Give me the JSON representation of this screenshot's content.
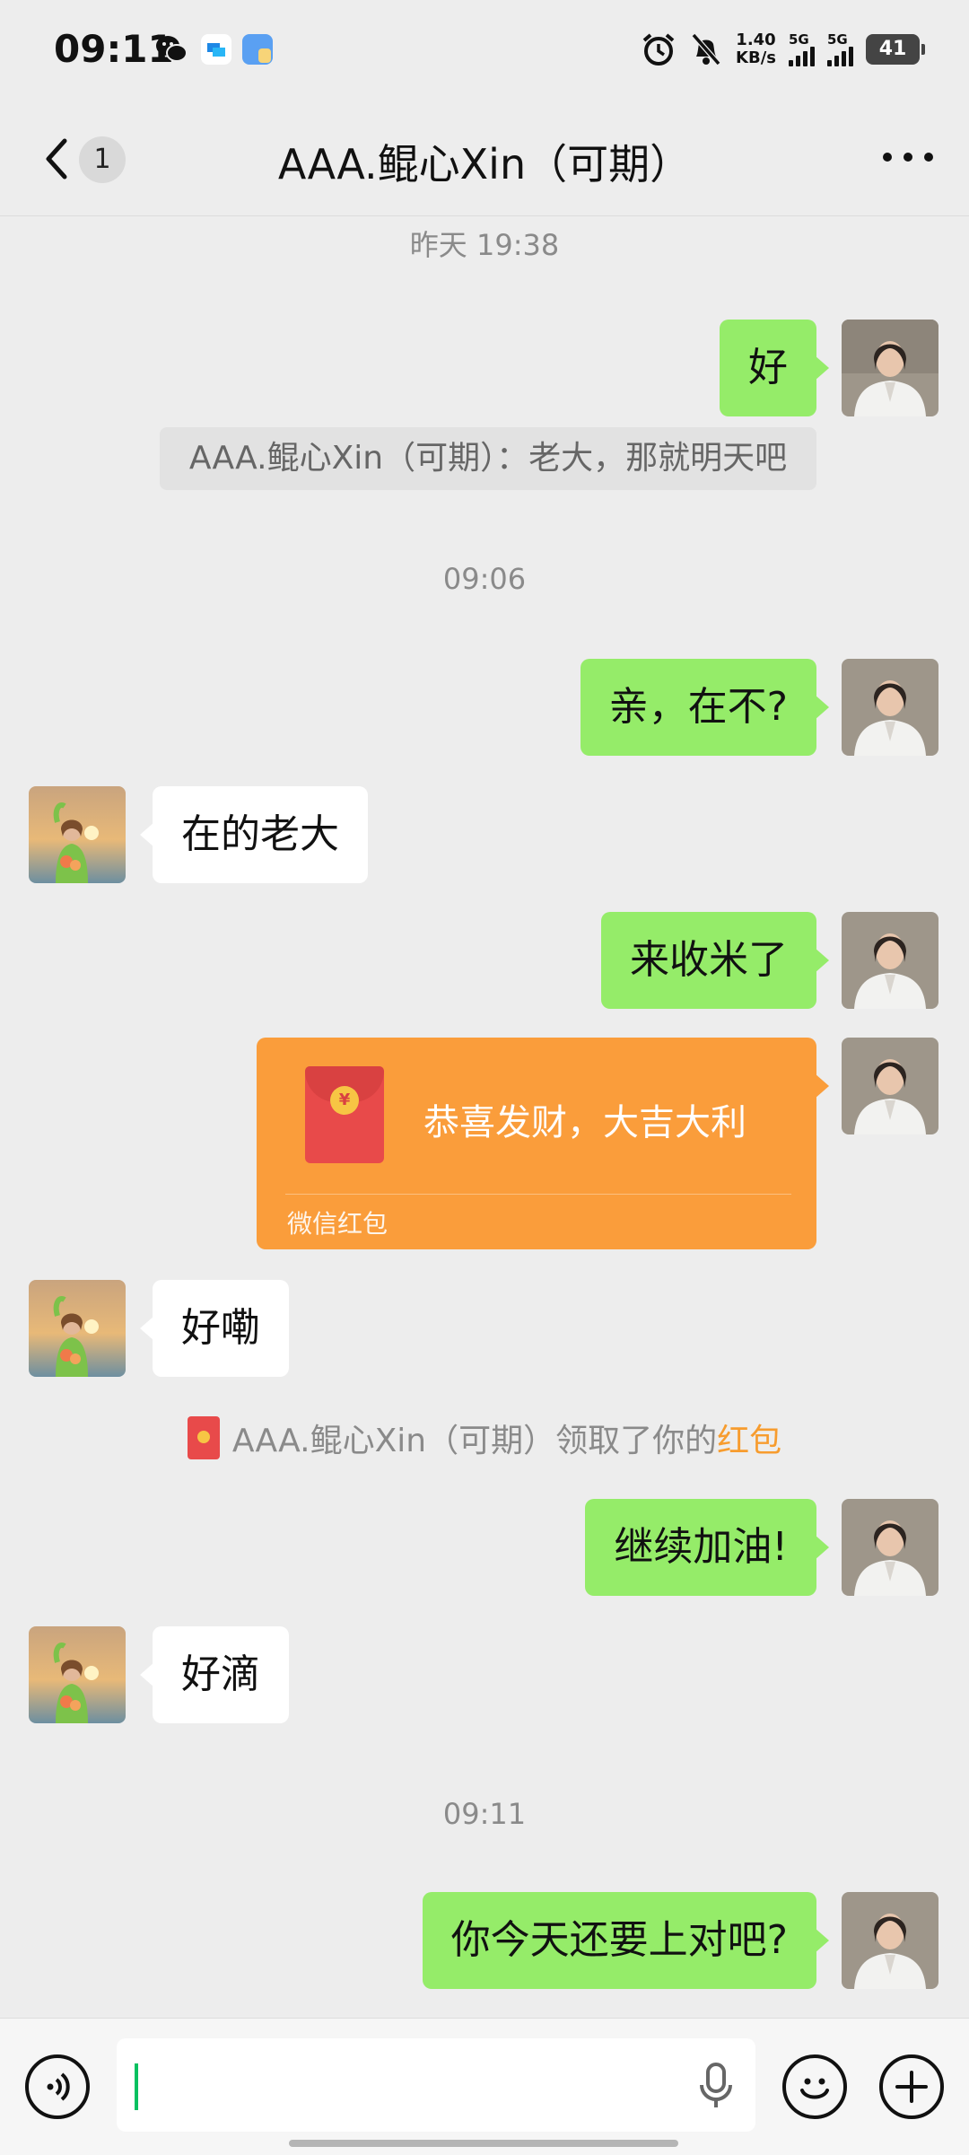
{
  "status_bar": {
    "time": "09:11",
    "net_speed_value": "1.40",
    "net_speed_unit": "KB/s",
    "sim1_label": "5G",
    "sim2_label": "5G",
    "battery": "41",
    "icons": [
      "wechat-icon",
      "app-icon",
      "app-icon",
      "alarm-icon",
      "mute-icon",
      "signal-icon",
      "battery-icon"
    ]
  },
  "header": {
    "unread_count": "1",
    "title": "AAA.鲲心Xin（可期）"
  },
  "messages": {
    "t1": "昨天 19:38",
    "m1": "好",
    "quote": "AAA.鲲心Xin（可期）：老大，那就明天吧",
    "t2": "09:06",
    "m2": "亲，在不?",
    "p1": "在的老大",
    "m3": "来收米了",
    "redpacket": {
      "title": "恭喜发财，大吉大利",
      "footer": "微信红包",
      "coin": "¥"
    },
    "p2": "好嘞",
    "system_note": {
      "text": "AAA.鲲心Xin（可期）领取了你的",
      "link": "红包"
    },
    "m4": "继续加油!",
    "p3": "好滴",
    "t3": "09:11",
    "m5": "你今天还要上对吧?"
  },
  "colors": {
    "background": "#EDEDED",
    "my_bubble": "#95EC69",
    "peer_bubble": "#FFFFFF",
    "red_packet": "#FA9D3B",
    "link": "#F79C2E",
    "caret": "#07C160"
  }
}
